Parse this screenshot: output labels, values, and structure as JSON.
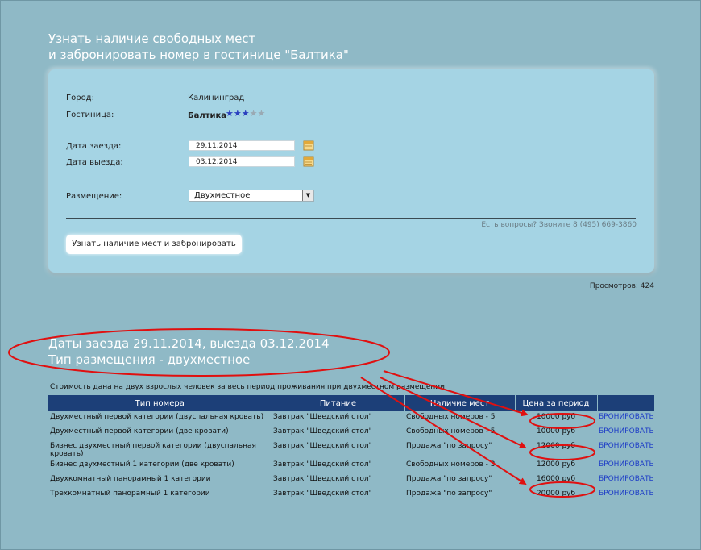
{
  "heading": {
    "line1": "Узнать наличие свободных мест",
    "line2": "и забронировать номер в гостинице \"Балтика\""
  },
  "form": {
    "city_label": "Город:",
    "city_value": "Калининград",
    "hotel_label": "Гостиница:",
    "hotel_value": "Балтика",
    "hotel_stars": 3,
    "hotel_stars_max": 5,
    "checkin_label": "Дата заезда:",
    "checkin_value": "29.11.2014",
    "checkout_label": "Дата выезда:",
    "checkout_value": "03.12.2014",
    "placement_label": "Размещение:",
    "placement_value": "Двухместное",
    "contact": "Есть вопросы? Звоните 8 (495) 669-3860",
    "submit_label": "Узнать наличие мест и забронировать"
  },
  "views": "Просмотров: 424",
  "results": {
    "line1": "Даты заезда 29.11.2014, выезда 03.12.2014",
    "line2": "Тип размещения - двухместное",
    "note": "Стоимость дана на двух взрослых человек за весь период проживания при двухместном размещении",
    "columns": [
      "Тип номера",
      "Питание",
      "Наличие мест",
      "Цена за период",
      ""
    ],
    "rows": [
      {
        "type": "Двухместный первой категории (двуспальная кровать)",
        "meal": "Завтрак \"Шведский стол\"",
        "avail": "Свободных номеров - 5",
        "price": "10000 руб",
        "book": "БРОНИРОВАТЬ"
      },
      {
        "type": "Двухместный первой категории (две кровати)",
        "meal": "Завтрак \"Шведский стол\"",
        "avail": "Свободных номеров - 5",
        "price": "10000 руб",
        "book": "БРОНИРОВАТЬ"
      },
      {
        "type": "Бизнес двухместный первой категории (двуспальная кровать)",
        "meal": "Завтрак \"Шведский стол\"",
        "avail": "Продажа \"по запросу\"",
        "price": "12000 руб",
        "book": "БРОНИРОВАТЬ"
      },
      {
        "type": "Бизнес двухместный 1 категории (две кровати)",
        "meal": "Завтрак \"Шведский стол\"",
        "avail": "Свободных номеров - 3",
        "price": "12000 руб",
        "book": "БРОНИРОВАТЬ"
      },
      {
        "type": "Двухкомнатный панорамный 1 категории",
        "meal": "Завтрак \"Шведский стол\"",
        "avail": "Продажа \"по запросу\"",
        "price": "16000 руб",
        "book": "БРОНИРОВАТЬ"
      },
      {
        "type": "Трехкомнатный панорамный 1 категории",
        "meal": "Завтрак \"Шведский стол\"",
        "avail": "Продажа \"по запросу\"",
        "price": "20000 руб",
        "book": "БРОНИРОВАТЬ"
      }
    ]
  },
  "colors": {
    "background": "#8fb9c6",
    "panel": "#a5d4e4",
    "table_header": "#1c3f78",
    "link": "#1f3ec7",
    "annotation": "#e01010"
  },
  "icons": {
    "star": "star-icon",
    "calendar": "calendar-icon",
    "dropdown": "chevron-down-icon"
  }
}
